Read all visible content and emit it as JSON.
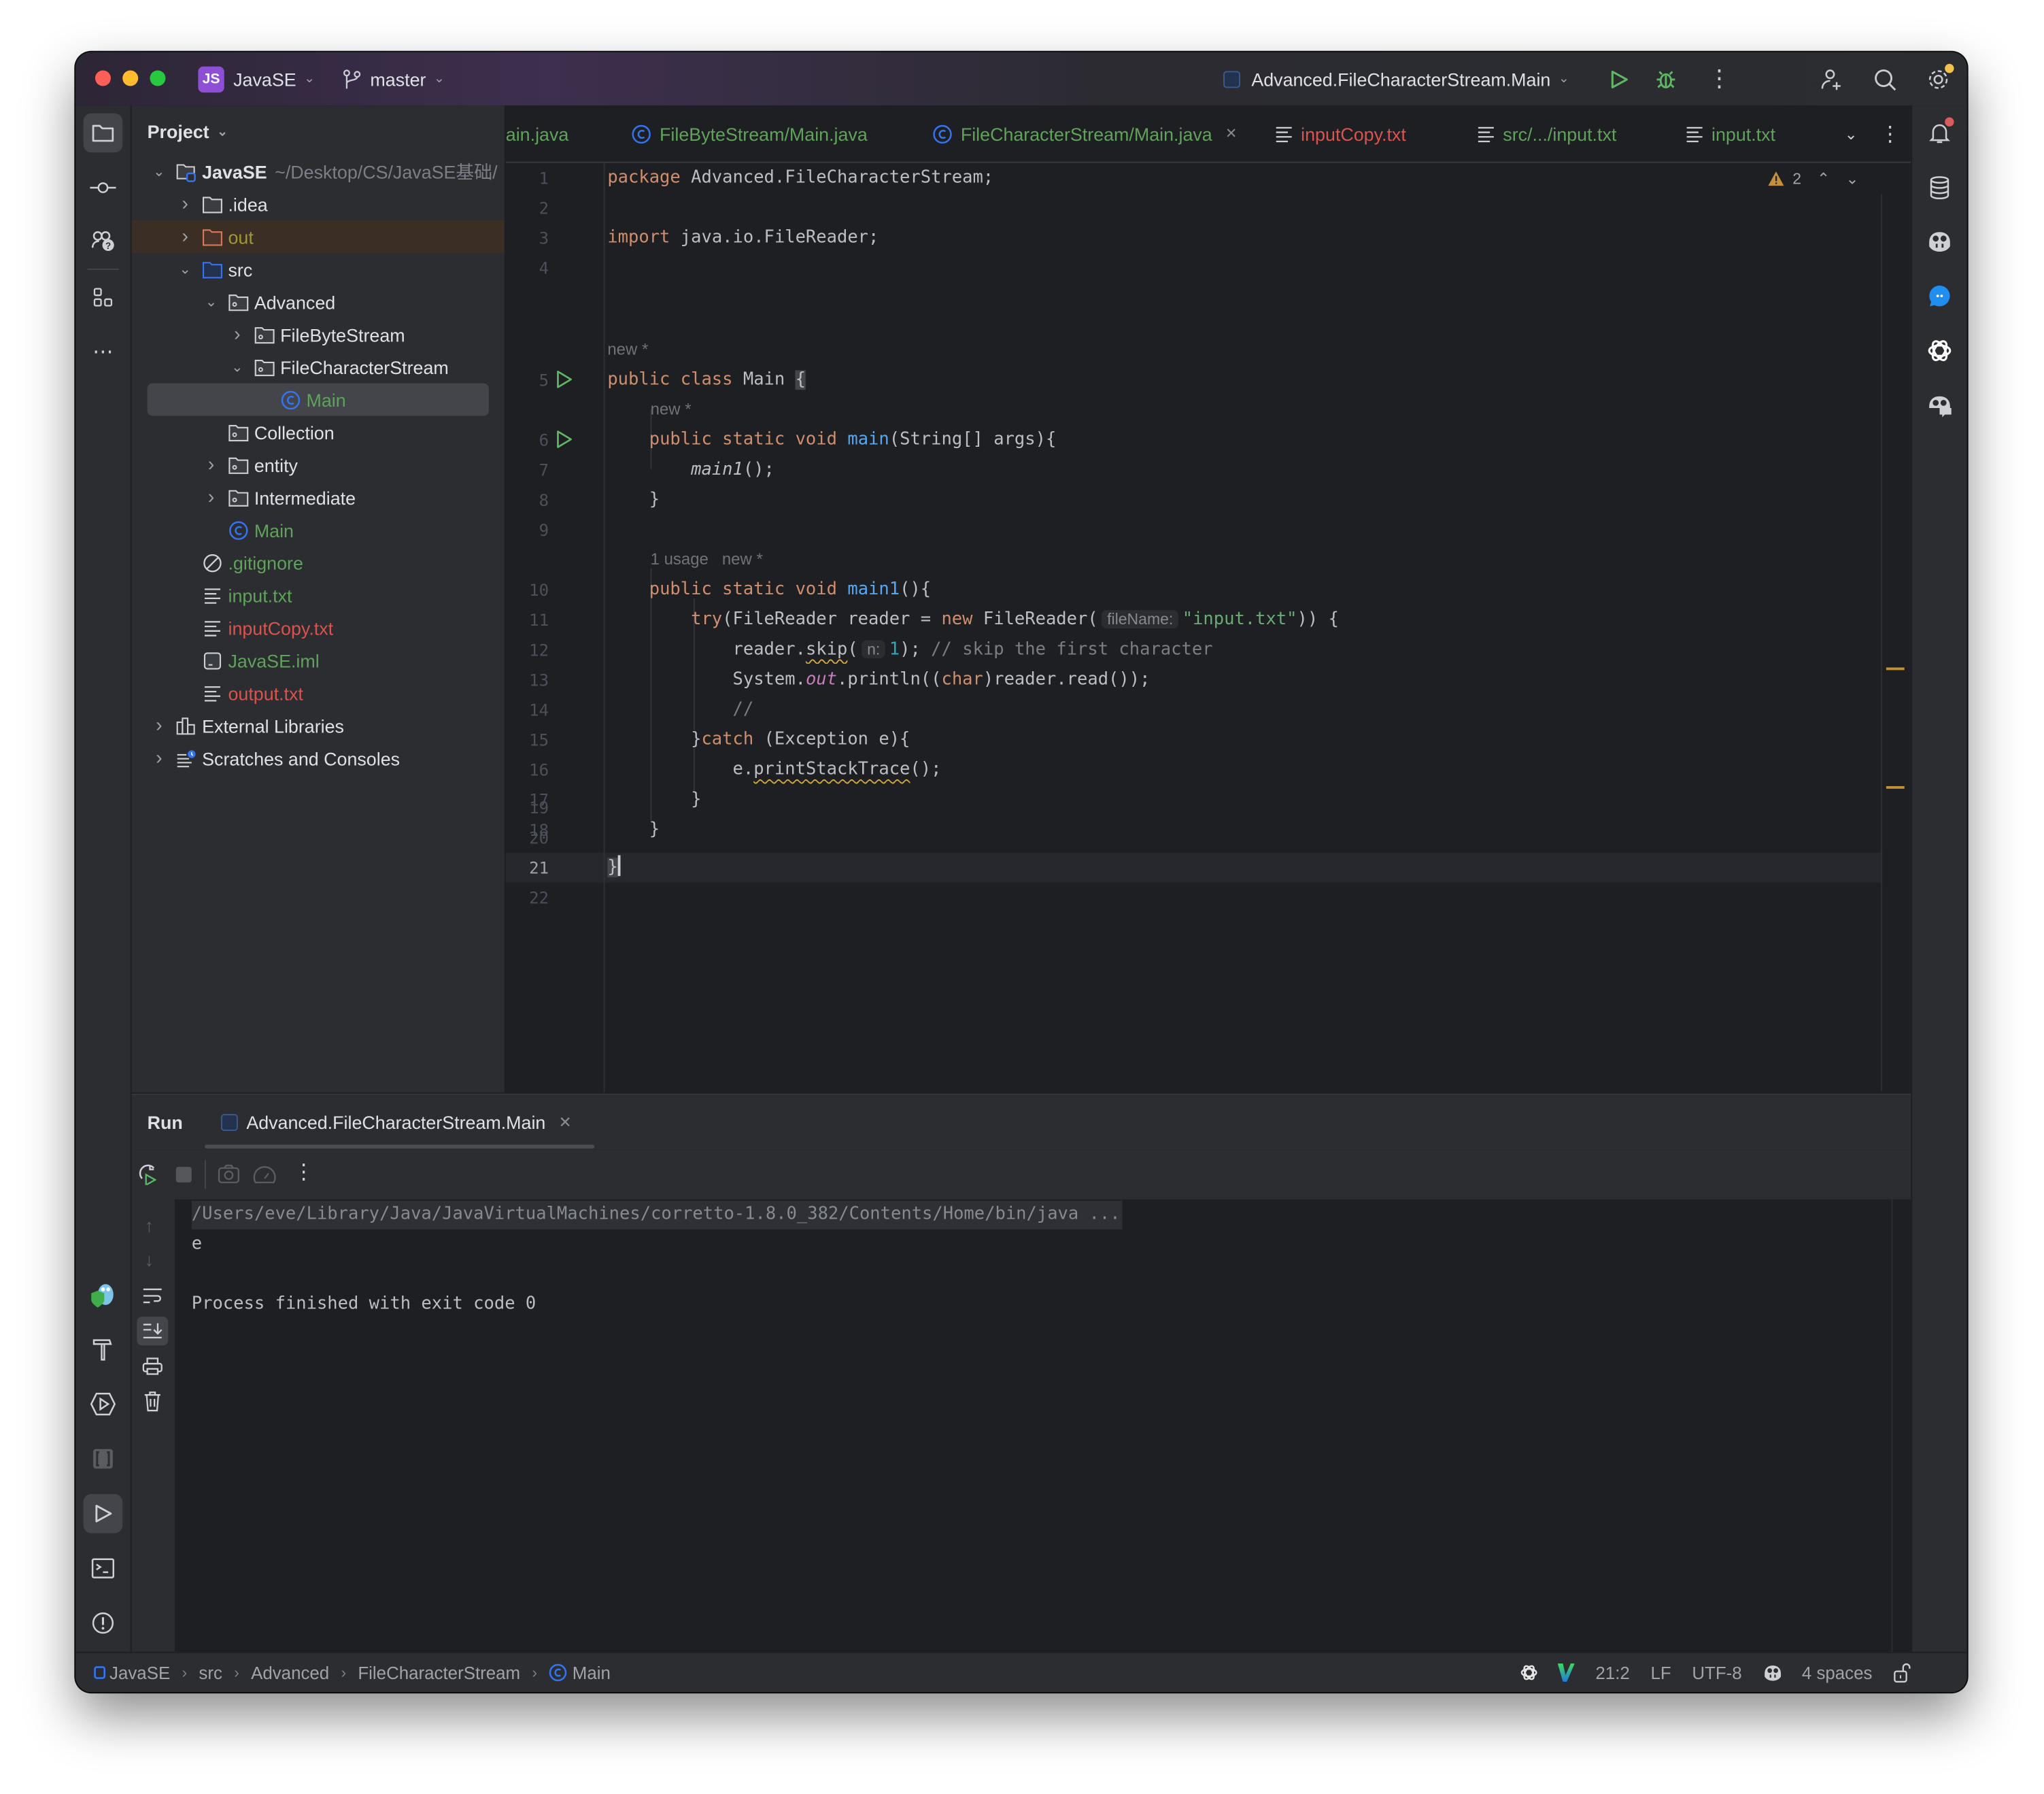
{
  "titlebar": {
    "project_badge": "JS",
    "project_name": "JavaSE",
    "branch": "master",
    "run_config": "Advanced.FileCharacterStream.Main"
  },
  "project_panel": {
    "title": "Project",
    "tree": [
      {
        "label": "JavaSE",
        "suffix": "~/Desktop/CS/JavaSE基础/",
        "depth": 0,
        "expanded": true,
        "icon": "module-folder-icon",
        "color": "default",
        "bold": true
      },
      {
        "label": ".idea",
        "depth": 1,
        "expanded": false,
        "icon": "folder-icon",
        "color": "default"
      },
      {
        "label": "out",
        "depth": 1,
        "expanded": false,
        "icon": "excluded-folder-icon",
        "color": "olive",
        "highlight": true
      },
      {
        "label": "src",
        "depth": 1,
        "expanded": true,
        "icon": "source-folder-icon",
        "color": "default"
      },
      {
        "label": "Advanced",
        "depth": 2,
        "expanded": true,
        "icon": "package-icon",
        "color": "default"
      },
      {
        "label": "FileByteStream",
        "depth": 3,
        "expanded": false,
        "icon": "package-icon",
        "color": "default"
      },
      {
        "label": "FileCharacterStream",
        "depth": 3,
        "expanded": true,
        "icon": "package-icon",
        "color": "default"
      },
      {
        "label": "Main",
        "depth": 4,
        "icon": "class-icon",
        "color": "green",
        "selected": true
      },
      {
        "label": "Collection",
        "depth": 2,
        "icon": "package-icon",
        "color": "default",
        "leaf": true
      },
      {
        "label": "entity",
        "depth": 2,
        "expanded": false,
        "icon": "package-icon",
        "color": "default"
      },
      {
        "label": "Intermediate",
        "depth": 2,
        "expanded": false,
        "icon": "package-icon",
        "color": "default"
      },
      {
        "label": "Main",
        "depth": 2,
        "icon": "class-icon",
        "color": "green",
        "leaf": true
      },
      {
        "label": ".gitignore",
        "depth": 1,
        "icon": "ignore-file-icon",
        "color": "green",
        "leaf": true
      },
      {
        "label": "input.txt",
        "depth": 1,
        "icon": "text-file-icon",
        "color": "green",
        "leaf": true
      },
      {
        "label": "inputCopy.txt",
        "depth": 1,
        "icon": "text-file-icon",
        "color": "red",
        "leaf": true
      },
      {
        "label": "JavaSE.iml",
        "depth": 1,
        "icon": "iml-file-icon",
        "color": "green",
        "leaf": true
      },
      {
        "label": "output.txt",
        "depth": 1,
        "icon": "text-file-icon",
        "color": "red",
        "leaf": true
      },
      {
        "label": "External Libraries",
        "depth": 0,
        "expanded": false,
        "icon": "libraries-icon",
        "color": "default"
      },
      {
        "label": "Scratches and Consoles",
        "depth": 0,
        "expanded": false,
        "icon": "scratches-icon",
        "color": "default"
      }
    ]
  },
  "editor_tabs": [
    {
      "label": "ain.java",
      "color": "green",
      "icon": "none"
    },
    {
      "label": "FileByteStream/Main.java",
      "color": "green",
      "icon": "class-icon"
    },
    {
      "label": "FileCharacterStream/Main.java",
      "color": "green",
      "icon": "class-icon",
      "active": true,
      "closable": true
    },
    {
      "label": "inputCopy.txt",
      "color": "red",
      "icon": "text-file-icon"
    },
    {
      "label": "src/.../input.txt",
      "color": "green",
      "icon": "text-file-icon"
    },
    {
      "label": "input.txt",
      "color": "green",
      "icon": "text-file-icon"
    }
  ],
  "editor": {
    "warnings_count": "2",
    "cursor_line": 21,
    "hints": {
      "class_hint": "new *",
      "main_hint": "new *",
      "main1_usage": "1 usage",
      "main1_hint": "new *",
      "inlay_filename": "fileName:",
      "inlay_n": "n:"
    },
    "lines": [
      {
        "n": 1,
        "text": "package Advanced.FileCharacterStream;"
      },
      {
        "n": 2,
        "text": ""
      },
      {
        "n": 3,
        "text": "import java.io.FileReader;"
      },
      {
        "n": 4,
        "text": ""
      },
      {
        "n": 5,
        "text": "public class Main {"
      },
      {
        "n": 6,
        "text": "    public static void main(String[] args){"
      },
      {
        "n": 7,
        "text": "        main1();"
      },
      {
        "n": 8,
        "text": "    }"
      },
      {
        "n": 9,
        "text": ""
      },
      {
        "n": 10,
        "text": "    public static void main1(){"
      },
      {
        "n": 11,
        "text": "        try(FileReader reader = new FileReader(\"input.txt\")) {"
      },
      {
        "n": 12,
        "text": "            reader.skip(1); // skip the first character"
      },
      {
        "n": 13,
        "text": "            System.out.println((char)reader.read());"
      },
      {
        "n": 14,
        "text": "            //"
      },
      {
        "n": 15,
        "text": "        }catch (Exception e){"
      },
      {
        "n": 16,
        "text": "            e.printStackTrace();"
      },
      {
        "n": 17,
        "text": "        }"
      },
      {
        "n": 18,
        "text": "    }"
      },
      {
        "n": 19,
        "text": ""
      },
      {
        "n": 20,
        "text": ""
      },
      {
        "n": 21,
        "text": "}"
      },
      {
        "n": 22,
        "text": ""
      }
    ],
    "tokens": {
      "l1_kw": "package",
      "l1_rest": " Advanced.FileCharacterStream;",
      "l3_kw": "import",
      "l3_rest": " java.io.FileReader;",
      "l5_kw": "public class",
      "l5_name": " Main ",
      "l5_brace": "{",
      "l6_kw": "public static void",
      "l6_fn": "main",
      "l6_rest": "(String[] args){",
      "l7_call": "main1",
      "l7_rest": "();",
      "l8": "}",
      "l10_kw": "public static void",
      "l10_fn": "main1",
      "l10_rest": "(){",
      "l11_try": "try",
      "l11_a": "(FileReader reader = ",
      "l11_new": "new",
      "l11_b": " FileReader(",
      "l11_str": "\"input.txt\"",
      "l11_c": ")) {",
      "l12_a": "reader.",
      "l12_skip": "skip",
      "l12_b": "(",
      "l12_num": "1",
      "l12_c": "); ",
      "l12_cm": "// skip the first character",
      "l13_a": "System.",
      "l13_out": "out",
      "l13_b": ".println((",
      "l13_char": "char",
      "l13_c": ")reader.read());",
      "l14_cm": "//",
      "l15_a": "}",
      "l15_catch": "catch",
      "l15_b": " (Exception e){",
      "l16_a": "e.",
      "l16_fn": "printStackTrace",
      "l16_b": "();",
      "l17": "}",
      "l18": "}",
      "l21": "}"
    }
  },
  "run_panel": {
    "title": "Run",
    "tab_label": "Advanced.FileCharacterStream.Main",
    "console": [
      "/Users/eve/Library/Java/JavaVirtualMachines/corretto-1.8.0_382/Contents/Home/bin/java ...",
      "e",
      "",
      "Process finished with exit code 0"
    ]
  },
  "status_bar": {
    "breadcrumbs": [
      "JavaSE",
      "src",
      "Advanced",
      "FileCharacterStream",
      "Main"
    ],
    "position": "21:2",
    "line_separator": "LF",
    "encoding": "UTF-8",
    "indent": "4 spaces"
  },
  "colors": {
    "accent": "#3574f0",
    "vcs_added": "#5fa35a",
    "vcs_unversioned": "#d9534f",
    "warning": "#c3913a"
  }
}
